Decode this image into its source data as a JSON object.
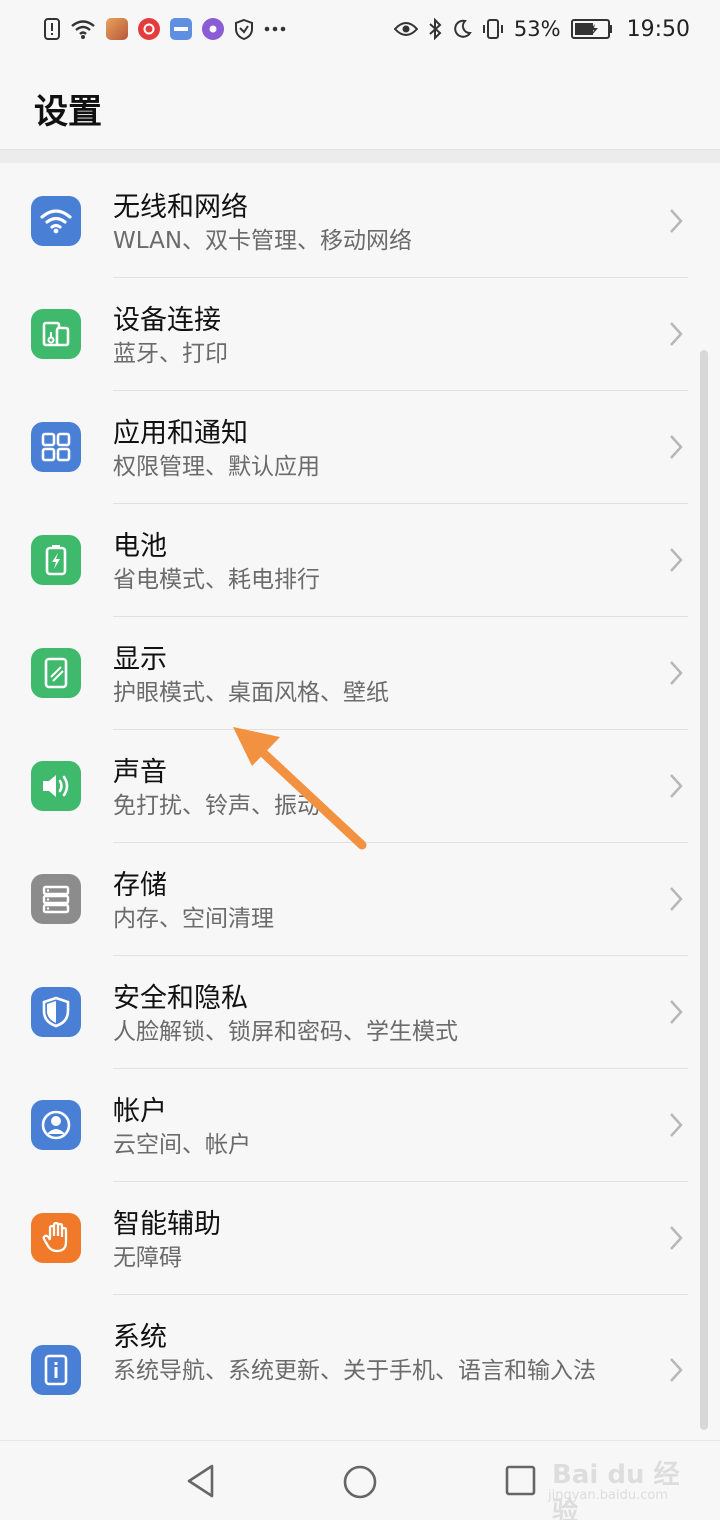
{
  "status_bar": {
    "battery_percent": "53%",
    "time": "19:50",
    "icons_left": [
      "alert-icon",
      "wifi-icon",
      "game-app-icon",
      "netease-music-icon",
      "fm-app-icon",
      "purple-app-icon",
      "shield-icon",
      "more-icon"
    ],
    "icons_right": [
      "eye-icon",
      "bluetooth-icon",
      "moon-icon",
      "vibrate-icon",
      "battery-icon"
    ]
  },
  "header": {
    "title": "设置"
  },
  "settings": [
    {
      "id": "wireless",
      "title": "无线和网络",
      "subtitle": "WLAN、双卡管理、移动网络",
      "icon": "wifi-icon",
      "color": "#4a7fd6"
    },
    {
      "id": "device-connection",
      "title": "设备连接",
      "subtitle": "蓝牙、打印",
      "icon": "device-connection-icon",
      "color": "#3fb96b"
    },
    {
      "id": "apps",
      "title": "应用和通知",
      "subtitle": "权限管理、默认应用",
      "icon": "apps-grid-icon",
      "color": "#4a7fd6"
    },
    {
      "id": "battery",
      "title": "电池",
      "subtitle": "省电模式、耗电排行",
      "icon": "battery-icon",
      "color": "#3fb96b"
    },
    {
      "id": "display",
      "title": "显示",
      "subtitle": "护眼模式、桌面风格、壁纸",
      "icon": "display-icon",
      "color": "#3fb96b"
    },
    {
      "id": "sound",
      "title": "声音",
      "subtitle": "免打扰、铃声、振动",
      "icon": "speaker-icon",
      "color": "#3fb96b"
    },
    {
      "id": "storage",
      "title": "存储",
      "subtitle": "内存、空间清理",
      "icon": "storage-icon",
      "color": "#8c8c8c"
    },
    {
      "id": "security",
      "title": "安全和隐私",
      "subtitle": "人脸解锁、锁屏和密码、学生模式",
      "icon": "shield-icon",
      "color": "#4a7fd6"
    },
    {
      "id": "account",
      "title": "帐户",
      "subtitle": "云空间、帐户",
      "icon": "account-icon",
      "color": "#4a7fd6"
    },
    {
      "id": "accessibility",
      "title": "智能辅助",
      "subtitle": "无障碍",
      "icon": "hand-icon",
      "color": "#f07a2a"
    },
    {
      "id": "system",
      "title": "系统",
      "subtitle": "系统导航、系统更新、关于手机、语言和输入法",
      "icon": "info-icon",
      "color": "#4a7fd6"
    }
  ],
  "annotation": {
    "arrow_color": "#f2913f"
  },
  "nav_bar": {
    "buttons": [
      "back-icon",
      "home-icon",
      "recents-icon"
    ]
  },
  "watermark": {
    "line1": "Bai du 经验",
    "line2": "jingyan.baidu.com"
  }
}
